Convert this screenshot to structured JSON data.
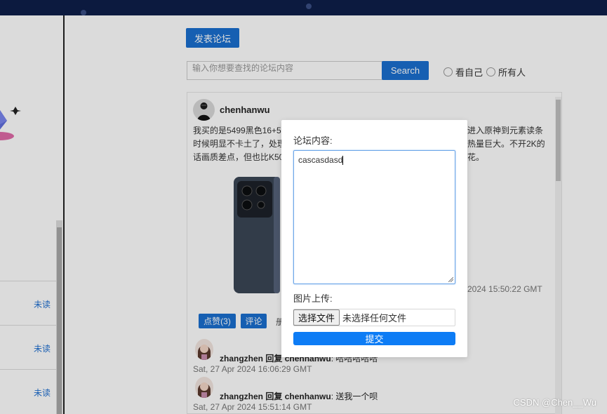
{
  "header": {
    "post_button": "发表论坛"
  },
  "search": {
    "placeholder": "输入你想要查找的论坛内容",
    "button": "Search",
    "filter_self": "看自己",
    "filter_all": "所有人"
  },
  "sidebar": {
    "items": [
      {
        "status": "未读"
      },
      {
        "status": "未读"
      },
      {
        "status": "未读"
      }
    ]
  },
  "post": {
    "user": "chenhanwu",
    "text_lines": [
      "我买的是5499黑色16+5",
      "时候明显不卡土了，处理",
      "话画质差点，但也比K50"
    ],
    "text_right_lines": [
      "进入原神到元素读条",
      "热量巨大。不开2K的",
      "花。"
    ],
    "date": "2024 15:50:22 GMT",
    "like_button": "点赞(3)",
    "comment_button": "评论",
    "extra_button_partial": "册"
  },
  "replies": [
    {
      "user": "zhangzhen",
      "verb": "回复",
      "target": "chenhanwu",
      "message": "哈哈哈哈哈",
      "date": "Sat, 27 Apr 2024 16:06:29 GMT"
    },
    {
      "user": "zhangzhen",
      "verb": "回复",
      "target": "chenhanwu",
      "message": "送我一个呗",
      "date": "Sat, 27 Apr 2024 15:51:14 GMT"
    }
  ],
  "modal": {
    "content_label": "论坛内容:",
    "content_value": "cascasdasd",
    "image_label": "图片上传:",
    "file_button": "选择文件",
    "file_status": "未选择任何文件",
    "submit": "提交"
  },
  "watermark": "CSDN @Chen__Wu",
  "colors": {
    "primary": "#1a6fd0",
    "submit": "#0d7cf5",
    "topbar": "#0f1f4a"
  }
}
